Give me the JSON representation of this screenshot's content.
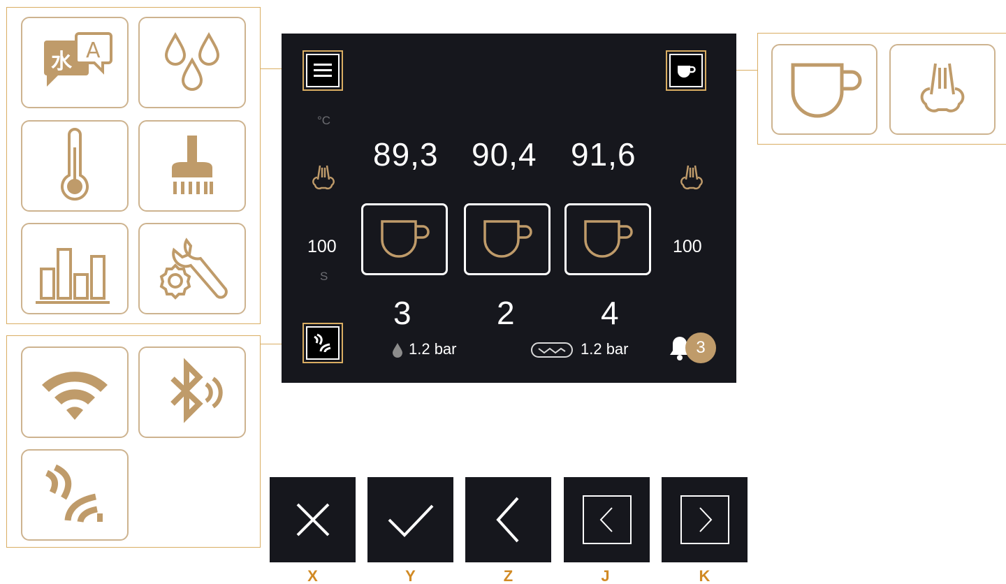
{
  "screen": {
    "temperature_unit": "°C",
    "temperatures": [
      "89,3",
      "90,4",
      "91,6"
    ],
    "steam_left_value": "100",
    "steam_right_value": "100",
    "count_unit": "S",
    "counts": [
      "3",
      "2",
      "4"
    ],
    "water_pressure": "1.2 bar",
    "pump_pressure": "1.2 bar",
    "notification_count": "3"
  },
  "menu_icons": [
    "language-icon",
    "water-drops-icon",
    "thermometer-icon",
    "brush-cleaning-icon",
    "statistics-chart-icon",
    "settings-tools-icon"
  ],
  "connectivity_icons": [
    "wifi-icon",
    "bluetooth-icon",
    "nfc-icon"
  ],
  "beverage_icons": [
    "cup-icon",
    "steam-icon"
  ],
  "keys": [
    {
      "icon": "close-icon",
      "label": "X"
    },
    {
      "icon": "check-icon",
      "label": "Y"
    },
    {
      "icon": "back-icon",
      "label": "Z"
    },
    {
      "icon": "previous-icon",
      "label": "J"
    },
    {
      "icon": "next-icon",
      "label": "K"
    }
  ],
  "colors": {
    "accent": "#d9ad62",
    "icon_gold": "#bf9b6a",
    "screen_bg": "#16171d",
    "key_label": "#d18a24"
  }
}
